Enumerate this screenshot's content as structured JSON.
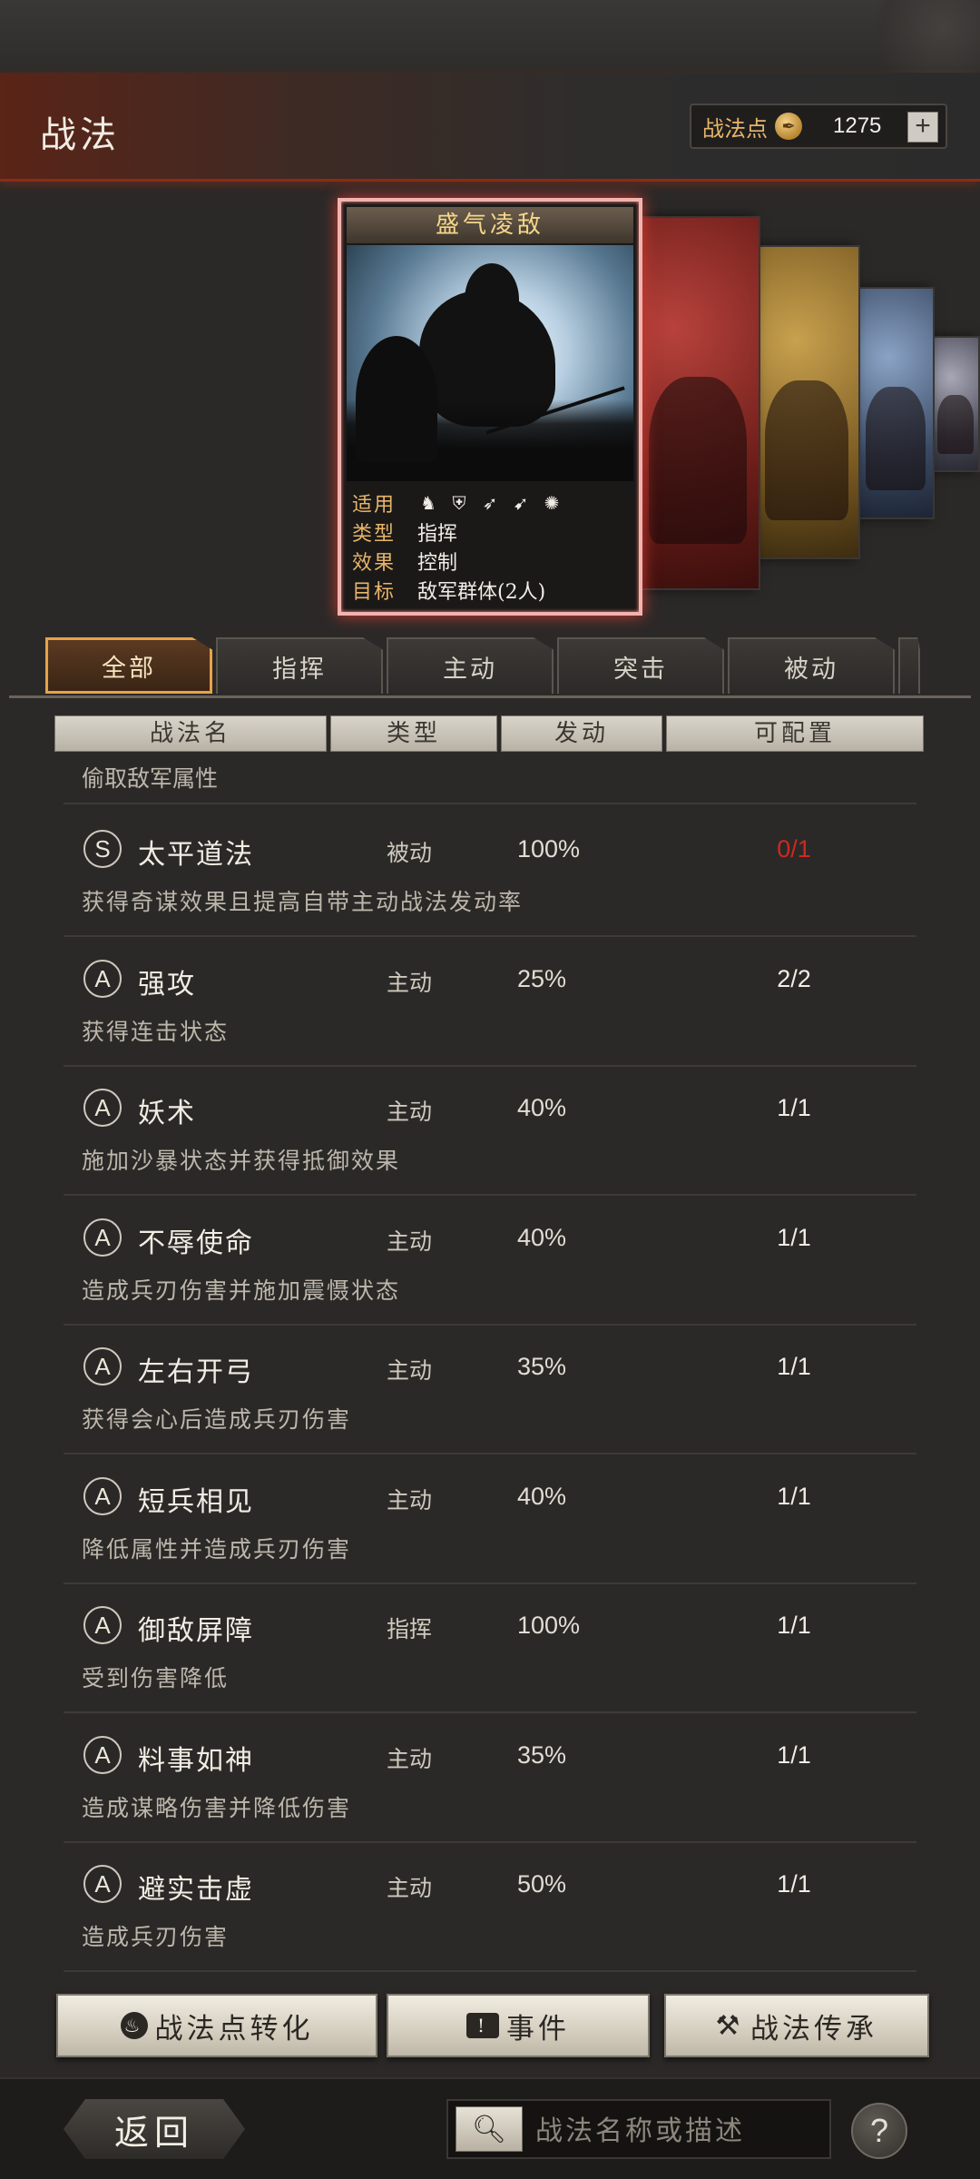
{
  "header": {
    "title": "战法",
    "points_label": "战法点",
    "points_value": "1275",
    "plus_label": "+"
  },
  "featured_card": {
    "title": "盛气凌敌",
    "apply_label": "适用",
    "apply_icons": [
      "cavalry-icon",
      "shield-icon",
      "bow-icon",
      "spear-icon",
      "wheel-icon"
    ],
    "type_label": "类型",
    "type_value": "指挥",
    "effect_label": "效果",
    "effect_value": "控制",
    "target_label": "目标",
    "target_value": "敌军群体(2人)"
  },
  "tabs": [
    {
      "label": "全部",
      "active": true
    },
    {
      "label": "指挥",
      "active": false
    },
    {
      "label": "主动",
      "active": false
    },
    {
      "label": "突击",
      "active": false
    },
    {
      "label": "被动",
      "active": false
    }
  ],
  "columns": [
    "战法名",
    "类型",
    "发动",
    "可配置"
  ],
  "list": {
    "partial_desc": "偷取敌军属性",
    "rows": [
      {
        "grade": "S",
        "name": "太平道法",
        "type": "被动",
        "rate": "100%",
        "avail": "0/1",
        "avail_red": true,
        "desc": "获得奇谋效果且提高自带主动战法发动率"
      },
      {
        "grade": "A",
        "name": "强攻",
        "type": "主动",
        "rate": "25%",
        "avail": "2/2",
        "avail_red": false,
        "desc": "获得连击状态"
      },
      {
        "grade": "A",
        "name": "妖术",
        "type": "主动",
        "rate": "40%",
        "avail": "1/1",
        "avail_red": false,
        "desc": "施加沙暴状态并获得抵御效果"
      },
      {
        "grade": "A",
        "name": "不辱使命",
        "type": "主动",
        "rate": "40%",
        "avail": "1/1",
        "avail_red": false,
        "desc": "造成兵刃伤害并施加震慑状态"
      },
      {
        "grade": "A",
        "name": "左右开弓",
        "type": "主动",
        "rate": "35%",
        "avail": "1/1",
        "avail_red": false,
        "desc": "获得会心后造成兵刃伤害"
      },
      {
        "grade": "A",
        "name": "短兵相见",
        "type": "主动",
        "rate": "40%",
        "avail": "1/1",
        "avail_red": false,
        "desc": "降低属性并造成兵刃伤害"
      },
      {
        "grade": "A",
        "name": "御敌屏障",
        "type": "指挥",
        "rate": "100%",
        "avail": "1/1",
        "avail_red": false,
        "desc": "受到伤害降低"
      },
      {
        "grade": "A",
        "name": "料事如神",
        "type": "主动",
        "rate": "35%",
        "avail": "1/1",
        "avail_red": false,
        "desc": "造成谋略伤害并降低伤害"
      },
      {
        "grade": "A",
        "name": "避实击虚",
        "type": "主动",
        "rate": "50%",
        "avail": "1/1",
        "avail_red": false,
        "desc": "造成兵刃伤害"
      }
    ]
  },
  "bottom_buttons": {
    "convert": "战法点转化",
    "events": "事件",
    "inherit": "战法传承"
  },
  "footer": {
    "back": "返回",
    "search_placeholder": "战法名称或描述",
    "help": "?"
  },
  "colors": {
    "accent_gold": "#e8b56a",
    "active_tab_border": "#e7a24a",
    "card_border": "#f2b3ae",
    "unavailable_red": "#d0281f"
  }
}
